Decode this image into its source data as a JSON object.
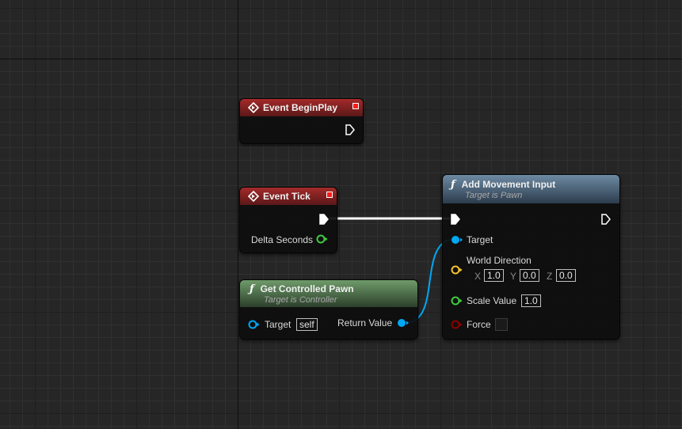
{
  "nodes": {
    "begin_play": {
      "title": "Event BeginPlay"
    },
    "event_tick": {
      "title": "Event Tick",
      "delta_seconds": "Delta Seconds"
    },
    "get_controlled_pawn": {
      "title": "Get Controlled Pawn",
      "subtitle": "Target is Controller",
      "target_label": "Target",
      "target_value": "self",
      "return_label": "Return Value"
    },
    "add_movement_input": {
      "title": "Add Movement Input",
      "subtitle": "Target is Pawn",
      "target_label": "Target",
      "world_direction_label": "World Direction",
      "x_label": "X",
      "x_value": "1.0",
      "y_label": "Y",
      "y_value": "0.0",
      "z_label": "Z",
      "z_value": "0.0",
      "scale_label": "Scale Value",
      "scale_value": "1.0",
      "force_label": "Force",
      "force_checked": false
    }
  },
  "colors": {
    "exec_pin": "#ffffff",
    "object_pin": "#00a8f4",
    "vector_pin": "#f4c22b",
    "float_pin": "#3ecc3e",
    "bool_pin": "#8c0000",
    "event_header": "#a52a2a",
    "pure_header": "#6f9b6a",
    "function_header": "#6d8aa3"
  },
  "icons": [
    "event-diamond-icon",
    "function-icon",
    "exec-pin-icon",
    "data-pin-icon"
  ]
}
